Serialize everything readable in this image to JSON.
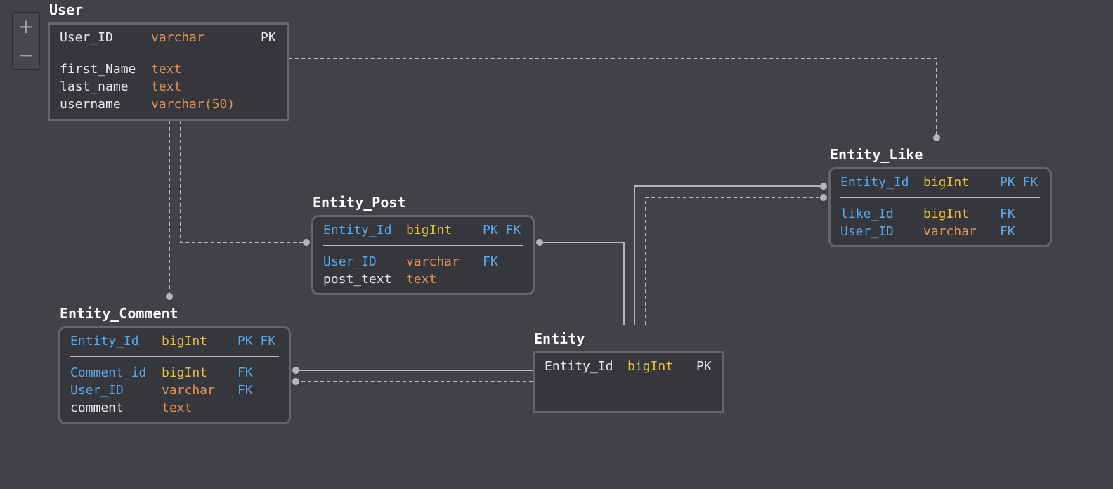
{
  "zoom": {
    "in_label": "+",
    "out_label": "−"
  },
  "tables": {
    "user": {
      "name": "User",
      "pk": {
        "field": "User_ID",
        "type": "varchar",
        "key": "PK"
      },
      "fields": [
        {
          "field": "first_Name",
          "type": "text",
          "key": ""
        },
        {
          "field": "last_name",
          "type": "text",
          "key": ""
        },
        {
          "field": "username",
          "type": "varchar(50)",
          "key": ""
        }
      ]
    },
    "entity_post": {
      "name": "Entity_Post",
      "pk": {
        "field": "Entity_Id",
        "type": "bigInt",
        "key": "PK FK"
      },
      "fields": [
        {
          "field": "User_ID",
          "type": "varchar",
          "key": "FK"
        },
        {
          "field": "post_text",
          "type": "text",
          "key": ""
        }
      ]
    },
    "entity_like": {
      "name": "Entity_Like",
      "pk": {
        "field": "Entity_Id",
        "type": "bigInt",
        "key": "PK FK"
      },
      "fields": [
        {
          "field": "like_Id",
          "type": "bigInt",
          "key": "FK"
        },
        {
          "field": "User_ID",
          "type": "varchar",
          "key": "FK"
        }
      ]
    },
    "entity_comment": {
      "name": "Entity_Comment",
      "pk": {
        "field": "Entity_Id",
        "type": "bigInt",
        "key": "PK FK"
      },
      "fields": [
        {
          "field": "Comment_id",
          "type": "bigInt",
          "key": "FK"
        },
        {
          "field": "User_ID",
          "type": "varchar",
          "key": "FK"
        },
        {
          "field": "comment",
          "type": "text",
          "key": ""
        }
      ]
    },
    "entity": {
      "name": "Entity",
      "pk": {
        "field": "Entity_Id",
        "type": "bigInt",
        "key": "PK"
      },
      "fields": []
    }
  },
  "colors": {
    "background": "#414248",
    "table_fill": "#36373c",
    "table_border": "#64656a",
    "text": "#e9e9e9",
    "fk_field": "#5aa6ea",
    "bigint_type": "#e8bf3c",
    "other_type": "#e09254",
    "connector": "#b5b6b9"
  }
}
